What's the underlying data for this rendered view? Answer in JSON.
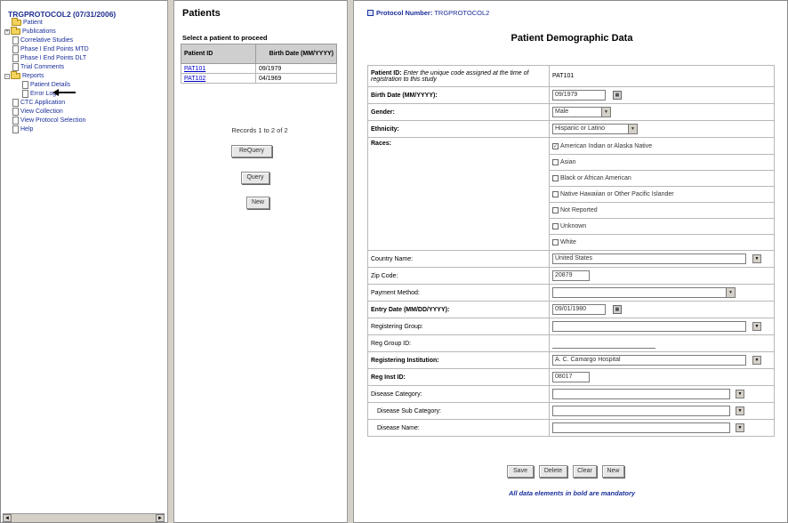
{
  "tree": {
    "title": "TRGPROTOCOL2 (07/31/2006)",
    "items": [
      {
        "label": "Patient",
        "icon": "folder"
      },
      {
        "label": "Publications",
        "icon": "folder"
      },
      {
        "label": "Correlative Studies",
        "icon": "doc"
      },
      {
        "label": "Phase I End Points MTD",
        "icon": "doc"
      },
      {
        "label": "Phase I End Points DLT",
        "icon": "doc"
      },
      {
        "label": "Trial Comments",
        "icon": "doc"
      },
      {
        "label": "Reports",
        "icon": "folder-open"
      },
      {
        "label": "Patient Details",
        "icon": "doc"
      },
      {
        "label": "Error Logs",
        "icon": "doc"
      },
      {
        "label": "CTC Application",
        "icon": "doc"
      },
      {
        "label": "View Collection",
        "icon": "doc"
      },
      {
        "label": "View Protocol Selection",
        "icon": "doc"
      },
      {
        "label": "Help",
        "icon": "doc"
      }
    ]
  },
  "patients": {
    "heading": "Patients",
    "select_prompt": "Select a patient to proceed",
    "columns": [
      "Patient ID",
      "Birth Date (MM/YYYY)"
    ],
    "rows": [
      {
        "id": "PAT101",
        "birth": "09/1979"
      },
      {
        "id": "PAT102",
        "birth": "04/1969"
      }
    ],
    "records_text": "Records 1 to 2 of 2",
    "buttons": {
      "requery": "ReQuery",
      "query": "Query",
      "new": "New"
    }
  },
  "form": {
    "protocol_label": "Protocol Number:",
    "protocol_value": "TRGPROTOCOL2",
    "title": "Patient Demographic Data",
    "patient_id_label_bold": "Patient ID:",
    "patient_id_hint": "Enter the unique code assigned at the time of registration to this study",
    "patient_id_value": "PAT101",
    "birth_label": "Birth Date (MM/YYYY):",
    "birth_value": "09/1979",
    "gender_label": "Gender:",
    "gender_value": "Male",
    "ethnicity_label": "Ethnicity:",
    "ethnicity_value": "Hispanic or Latino",
    "races_label": "Races:",
    "races": [
      {
        "label": "American Indian or Alaska Native",
        "checked": true
      },
      {
        "label": "Asian",
        "checked": false
      },
      {
        "label": "Black or African American",
        "checked": false
      },
      {
        "label": "Native Hawaiian or Other Pacific Islander",
        "checked": false
      },
      {
        "label": "Not Reported",
        "checked": false
      },
      {
        "label": "Unknown",
        "checked": false
      },
      {
        "label": "White",
        "checked": false
      }
    ],
    "country_label": "Country Name:",
    "country_value": "United States",
    "zip_label": "Zip Code:",
    "zip_value": "20879",
    "payment_label": "Payment Method:",
    "payment_value": "",
    "entry_label": "Entry Date (MM/DD/YYYY):",
    "entry_value": "09/01/1980",
    "reg_group_label": "Registering Group:",
    "reg_group_value": "",
    "reg_group_id_label": "Reg Group ID:",
    "reg_group_id_value": "",
    "reg_inst_label": "Registering Institution:",
    "reg_inst_value": "A. C. Camargo Hospital",
    "reg_inst_id_label": "Reg Inst ID:",
    "reg_inst_id_value": "08017",
    "disease_cat_label": "Disease Category:",
    "disease_sub_label": "Disease Sub Category:",
    "disease_name_label": "Disease Name:",
    "buttons": {
      "save": "Save",
      "delete": "Delete",
      "clear": "Clear",
      "new": "New"
    },
    "mandatory_note": "All data elements in bold are mandatory"
  }
}
